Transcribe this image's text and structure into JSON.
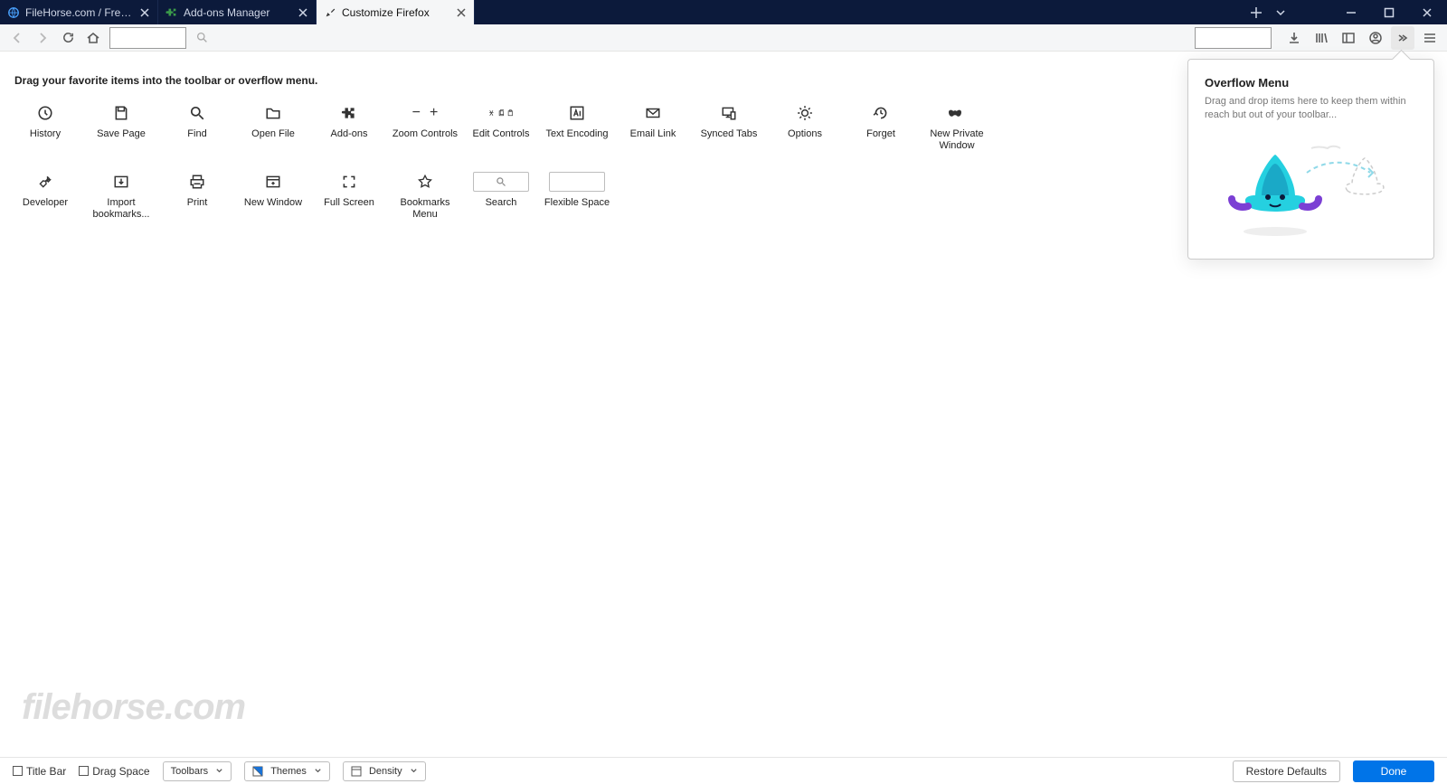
{
  "tabs": [
    {
      "label": "FileHorse.com / Free Software"
    },
    {
      "label": "Add-ons Manager"
    },
    {
      "label": "Customize Firefox"
    }
  ],
  "instruction": "Drag your favorite items into the toolbar or overflow menu.",
  "palette": {
    "row1": [
      "History",
      "Save Page",
      "Find",
      "Open File",
      "Add-ons",
      "Zoom Controls",
      "Edit Controls",
      "Text Encoding",
      "Email Link",
      "Synced Tabs",
      "Options",
      "Forget",
      "New Private Window"
    ],
    "row2": [
      "Developer",
      "Import bookmarks...",
      "Print",
      "New Window",
      "Full Screen",
      "Bookmarks Menu",
      "Search",
      "Flexible Space"
    ]
  },
  "overflow": {
    "title": "Overflow Menu",
    "desc": "Drag and drop items here to keep them within reach but out of your toolbar..."
  },
  "bottom": {
    "titlebar": "Title Bar",
    "dragspace": "Drag Space",
    "toolbars": "Toolbars",
    "themes": "Themes",
    "density": "Density",
    "restore": "Restore Defaults",
    "done": "Done"
  },
  "watermark": "filehorse.com"
}
